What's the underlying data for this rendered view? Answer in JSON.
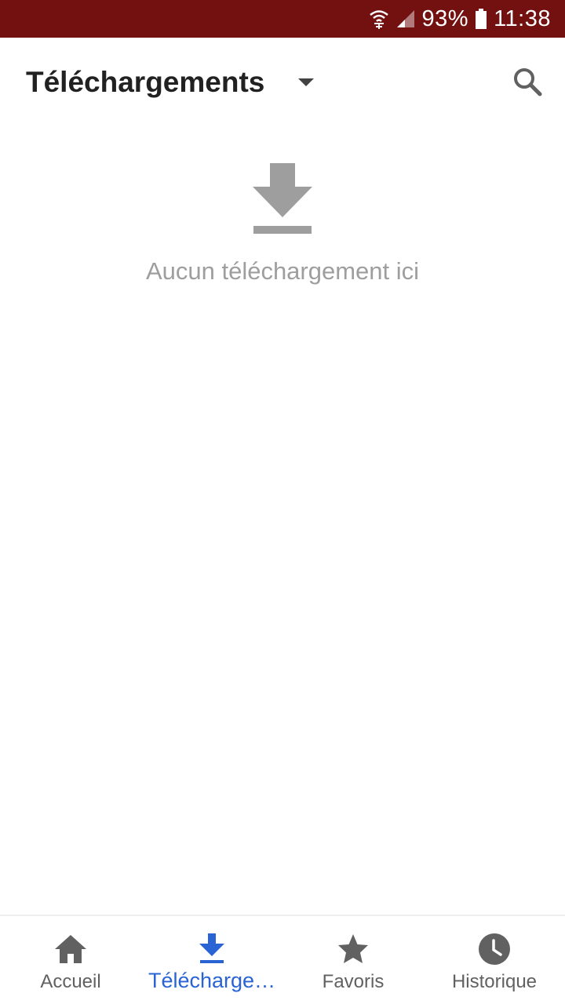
{
  "status_bar": {
    "battery": "93%",
    "time": "11:38",
    "icons": [
      "wifi-calling-icon",
      "signal-icon",
      "battery-icon"
    ],
    "background": "#731010"
  },
  "header": {
    "title": "Téléchargements",
    "dropdown_icon": "dropdown-arrow-icon",
    "search_icon": "search-icon"
  },
  "empty_state": {
    "icon": "download-icon",
    "message": "Aucun téléchargement ici"
  },
  "bottom_nav": {
    "active_color": "#2a63d4",
    "items": [
      {
        "label": "Accueil",
        "icon": "home-icon",
        "active": false
      },
      {
        "label": "Télécharge…",
        "icon": "download-icon",
        "active": true
      },
      {
        "label": "Favoris",
        "icon": "star-icon",
        "active": false
      },
      {
        "label": "Historique",
        "icon": "clock-icon",
        "active": false
      }
    ]
  }
}
